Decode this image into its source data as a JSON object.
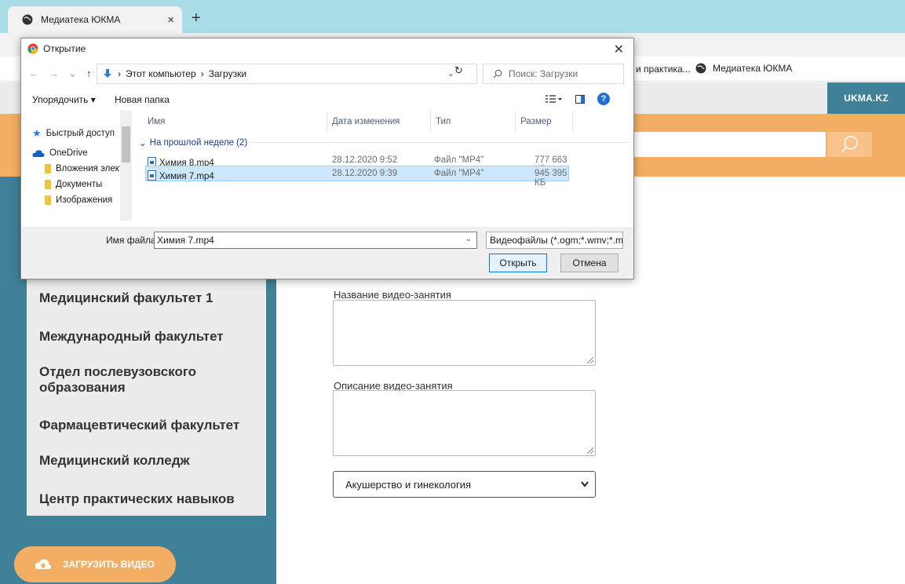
{
  "browser": {
    "tab_title": "Медиатека ЮКМА",
    "tab_close": "×",
    "new_tab": "+",
    "bookmarks": [
      "и практика...",
      "Медиатека ЮКМА"
    ]
  },
  "site": {
    "top_link": "UKMA.KZ",
    "sidebar_items": [
      "Медицинский факультет 1",
      "Международный факультет",
      "Отдел послевузовского образования",
      "Фармацевтический факультет",
      "Медицинский колледж",
      "Центр практических навыков"
    ],
    "upload_label": "ЗАГРУЗИТЬ ВИДЕО",
    "form": {
      "title_label": "Название видео-занятия",
      "description_label": "Описание видео-занятия",
      "category_selected": "Акушерство и гинекология"
    }
  },
  "dialog": {
    "title": "Открытие",
    "close": "✕",
    "path": [
      "Этот компьютер",
      "Загрузки"
    ],
    "path_sep": "›",
    "search_placeholder": "Поиск: Загрузки",
    "toolbar": {
      "sort": "Упорядочить ▾",
      "new_folder": "Новая папка"
    },
    "nav_pane": {
      "quick_access": "Быстрый доступ",
      "onedrive": "OneDrive",
      "folders": [
        "Вложения элект",
        "Документы",
        "Изображения"
      ]
    },
    "columns": {
      "name": "Имя",
      "date": "Дата изменения",
      "type": "Тип",
      "size": "Размер"
    },
    "group_label": "На прошлой неделе (2)",
    "files": [
      {
        "name": "Химия 8.mp4",
        "date": "28.12.2020 9:52",
        "type": "Файл \"MP4\"",
        "size": "777 663 КБ"
      },
      {
        "name": "Химия 7.mp4",
        "date": "28.12.2020 9:39",
        "type": "Файл \"MP4\"",
        "size": "945 395 КБ"
      }
    ],
    "filename_label": "Имя файла:",
    "filename_value": "Химия 7.mp4",
    "filter": "Видеофайлы (*.ogm;*.wmv;*.m",
    "open_button": "Открыть",
    "cancel_button": "Отмена"
  },
  "colors": {
    "teal": "#3f8196",
    "orange": "#f4ae63",
    "selection": "#cce8ff"
  },
  "icons": [
    "globe-icon",
    "search-icon",
    "cloud-upload-icon",
    "chrome-icon",
    "download-arrow-icon",
    "refresh-icon",
    "star-icon",
    "cloud-icon",
    "folder-icon",
    "file-icon",
    "help-icon"
  ]
}
